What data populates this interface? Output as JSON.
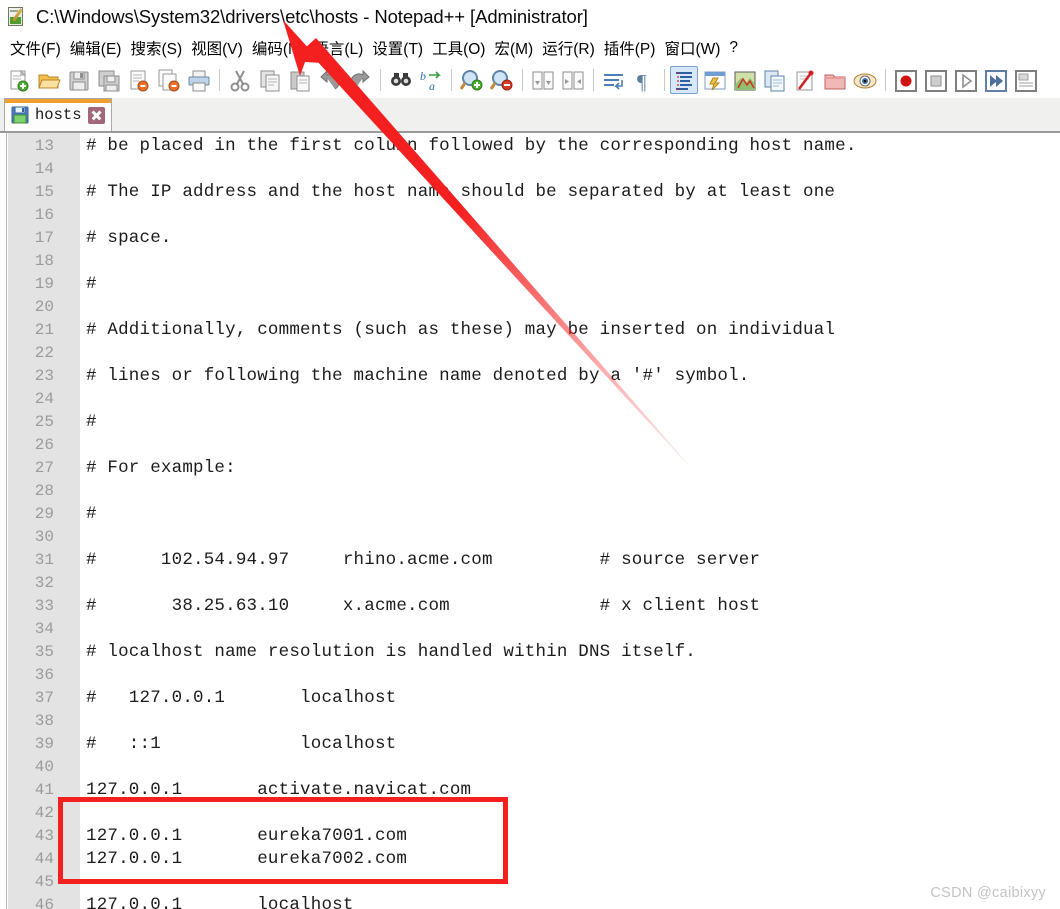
{
  "window": {
    "title": "C:\\Windows\\System32\\drivers\\etc\\hosts - Notepad++ [Administrator]",
    "app_icon": "notepad-plus-plus-icon"
  },
  "menubar": {
    "items": [
      {
        "label": "文件(F)",
        "name": "menu-file"
      },
      {
        "label": "编辑(E)",
        "name": "menu-edit"
      },
      {
        "label": "搜索(S)",
        "name": "menu-search"
      },
      {
        "label": "视图(V)",
        "name": "menu-view"
      },
      {
        "label": "编码(N)",
        "name": "menu-encoding"
      },
      {
        "label": "语言(L)",
        "name": "menu-language"
      },
      {
        "label": "设置(T)",
        "name": "menu-settings"
      },
      {
        "label": "工具(O)",
        "name": "menu-tools"
      },
      {
        "label": "宏(M)",
        "name": "menu-macro"
      },
      {
        "label": "运行(R)",
        "name": "menu-run"
      },
      {
        "label": "插件(P)",
        "name": "menu-plugins"
      },
      {
        "label": "窗口(W)",
        "name": "menu-window"
      },
      {
        "label": "?",
        "name": "menu-help"
      }
    ]
  },
  "toolbar": {
    "buttons": [
      {
        "icon": "new-file-icon",
        "selected": false
      },
      {
        "icon": "open-folder-icon",
        "selected": false
      },
      {
        "icon": "save-icon",
        "selected": false
      },
      {
        "icon": "save-all-icon",
        "selected": false
      },
      {
        "icon": "close-file-icon",
        "selected": false
      },
      {
        "icon": "close-all-files-icon",
        "selected": false
      },
      {
        "icon": "print-icon",
        "selected": false
      },
      {
        "sep": true
      },
      {
        "icon": "cut-icon",
        "selected": false
      },
      {
        "icon": "copy-icon",
        "selected": false
      },
      {
        "icon": "paste-icon",
        "selected": false
      },
      {
        "icon": "undo-icon",
        "selected": false
      },
      {
        "icon": "redo-icon",
        "selected": false
      },
      {
        "sep": true
      },
      {
        "icon": "find-icon",
        "selected": false
      },
      {
        "icon": "replace-icon",
        "selected": false
      },
      {
        "sep": true
      },
      {
        "icon": "zoom-in-icon",
        "selected": false
      },
      {
        "icon": "zoom-out-icon",
        "selected": false
      },
      {
        "sep": true
      },
      {
        "icon": "sync-vertical-scroll-icon",
        "selected": false
      },
      {
        "icon": "sync-horizontal-scroll-icon",
        "selected": false
      },
      {
        "sep": true
      },
      {
        "icon": "word-wrap-icon",
        "selected": false
      },
      {
        "icon": "show-all-characters-icon",
        "selected": false
      },
      {
        "sep": true
      },
      {
        "icon": "indent-guide-icon",
        "selected": true
      },
      {
        "icon": "user-defined-dialog-icon",
        "selected": false
      },
      {
        "icon": "document-map-icon",
        "selected": false
      },
      {
        "icon": "function-list-icon",
        "selected": false
      },
      {
        "icon": "file-browser-icon",
        "selected": false
      },
      {
        "icon": "folder-as-workspace-icon",
        "selected": false
      },
      {
        "icon": "document-preview-icon",
        "selected": false
      },
      {
        "sep": true
      },
      {
        "icon": "record-macro-icon",
        "selected": false
      },
      {
        "icon": "stop-macro-icon",
        "selected": false
      },
      {
        "icon": "play-macro-icon",
        "selected": false
      },
      {
        "icon": "run-macro-multiple-icon",
        "selected": false
      },
      {
        "icon": "save-macro-icon",
        "selected": false
      }
    ]
  },
  "tabs": [
    {
      "label": "hosts",
      "icon": "save-floppy-icon",
      "close": "close-tab-icon",
      "active": true,
      "modified": true
    }
  ],
  "editor": {
    "first_line_number": 13,
    "lines": [
      {
        "n": 13,
        "text": "# be placed in the first column followed by the corresponding host name."
      },
      {
        "n": 14,
        "text": ""
      },
      {
        "n": 15,
        "text": "# The IP address and the host name should be separated by at least one"
      },
      {
        "n": 16,
        "text": ""
      },
      {
        "n": 17,
        "text": "# space."
      },
      {
        "n": 18,
        "text": ""
      },
      {
        "n": 19,
        "text": "#"
      },
      {
        "n": 20,
        "text": ""
      },
      {
        "n": 21,
        "text": "# Additionally, comments (such as these) may be inserted on individual"
      },
      {
        "n": 22,
        "text": ""
      },
      {
        "n": 23,
        "text": "# lines or following the machine name denoted by a '#' symbol."
      },
      {
        "n": 24,
        "text": ""
      },
      {
        "n": 25,
        "text": "#"
      },
      {
        "n": 26,
        "text": ""
      },
      {
        "n": 27,
        "text": "# For example:"
      },
      {
        "n": 28,
        "text": ""
      },
      {
        "n": 29,
        "text": "#"
      },
      {
        "n": 30,
        "text": ""
      },
      {
        "n": 31,
        "text": "#      102.54.94.97     rhino.acme.com          # source server"
      },
      {
        "n": 32,
        "text": ""
      },
      {
        "n": 33,
        "text": "#       38.25.63.10     x.acme.com              # x client host"
      },
      {
        "n": 34,
        "text": ""
      },
      {
        "n": 35,
        "text": "# localhost name resolution is handled within DNS itself."
      },
      {
        "n": 36,
        "text": ""
      },
      {
        "n": 37,
        "text": "#   127.0.0.1       localhost"
      },
      {
        "n": 38,
        "text": ""
      },
      {
        "n": 39,
        "text": "#   ::1             localhost"
      },
      {
        "n": 40,
        "text": ""
      },
      {
        "n": 41,
        "text": "127.0.0.1       activate.navicat.com"
      },
      {
        "n": 42,
        "text": ""
      },
      {
        "n": 43,
        "text": "127.0.0.1       eureka7001.com"
      },
      {
        "n": 44,
        "text": "127.0.0.1       eureka7002.com"
      },
      {
        "n": 45,
        "text": ""
      },
      {
        "n": 46,
        "text": "127.0.0.1       localhost"
      }
    ]
  },
  "annotations": {
    "highlight_box": {
      "name": "red-highlight-box",
      "color": "#f42020",
      "targets_lines": [
        42,
        43,
        44,
        45
      ]
    },
    "arrow": {
      "name": "red-pointer-arrow",
      "color": "#f42020",
      "points_to": "title-bar-file-path"
    }
  },
  "watermark": {
    "text": "CSDN @caibixyy",
    "color": "#c3c3c3"
  }
}
